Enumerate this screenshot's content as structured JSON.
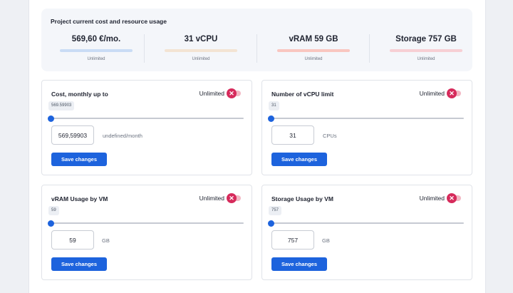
{
  "summary": {
    "title": "Project current cost and resource usage",
    "stats": [
      {
        "value": "569,60 €/mo.",
        "sub": "Unlimited",
        "bar_color": "#c9dcf5"
      },
      {
        "value": "31 vCPU",
        "sub": "Unlimited",
        "bar_color": "#f3e4d3"
      },
      {
        "value": "vRAM 59 GB",
        "sub": "Unlimited",
        "bar_color": "#f9c6c0"
      },
      {
        "value": "Storage 757 GB",
        "sub": "Unlimited",
        "bar_color": "#f7cfd4"
      }
    ]
  },
  "cards": [
    {
      "title": "Cost, monthly up to",
      "toggle_label": "Unlimited",
      "chip": "569.59903",
      "input_value": "569,59903",
      "unit": "undefined/month",
      "button": "Save changes",
      "slider_fraction": 0
    },
    {
      "title": "Number of vCPU limit",
      "toggle_label": "Unlimited",
      "chip": "31",
      "input_value": "31",
      "unit": "CPUs",
      "button": "Save changes",
      "slider_fraction": 0
    },
    {
      "title": "vRAM Usage by VM",
      "toggle_label": "Unlimited",
      "chip": "59",
      "input_value": "59",
      "unit": "GB",
      "button": "Save changes",
      "slider_fraction": 0
    },
    {
      "title": "Storage Usage by VM",
      "toggle_label": "Unlimited",
      "chip": "757",
      "input_value": "757",
      "unit": "GB",
      "button": "Save changes",
      "slider_fraction": 0
    }
  ],
  "icons": {
    "toggle_off": "close-x-icon"
  },
  "colors": {
    "accent": "#1d63dd",
    "toggle": "#d62a5b"
  }
}
